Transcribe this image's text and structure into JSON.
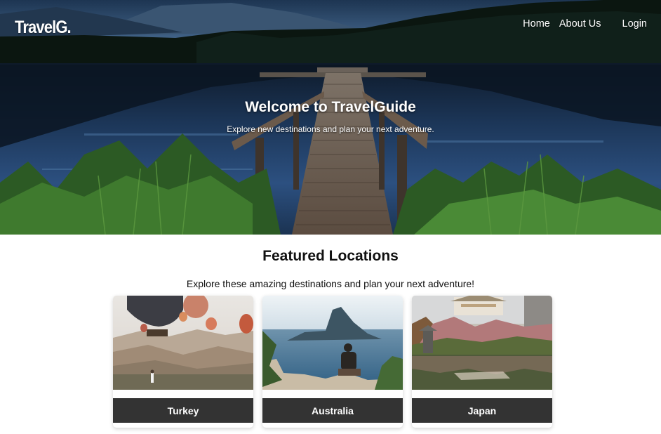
{
  "navbar": {
    "logo": "TravelG.",
    "links": [
      {
        "label": "Home"
      },
      {
        "label": "About Us"
      },
      {
        "label": "Login"
      }
    ]
  },
  "hero": {
    "title": "Welcome to TravelGuide",
    "subtitle": "Explore new destinations and plan your next adventure."
  },
  "featured": {
    "title": "Featured Locations",
    "subtitle": "Explore these amazing destinations and plan your next adventure!",
    "locations": [
      {
        "name": "Turkey"
      },
      {
        "name": "Australia"
      },
      {
        "name": "Japan"
      }
    ]
  },
  "colors": {
    "card_label_bg": "#333333",
    "nav_text": "#ffffff"
  }
}
